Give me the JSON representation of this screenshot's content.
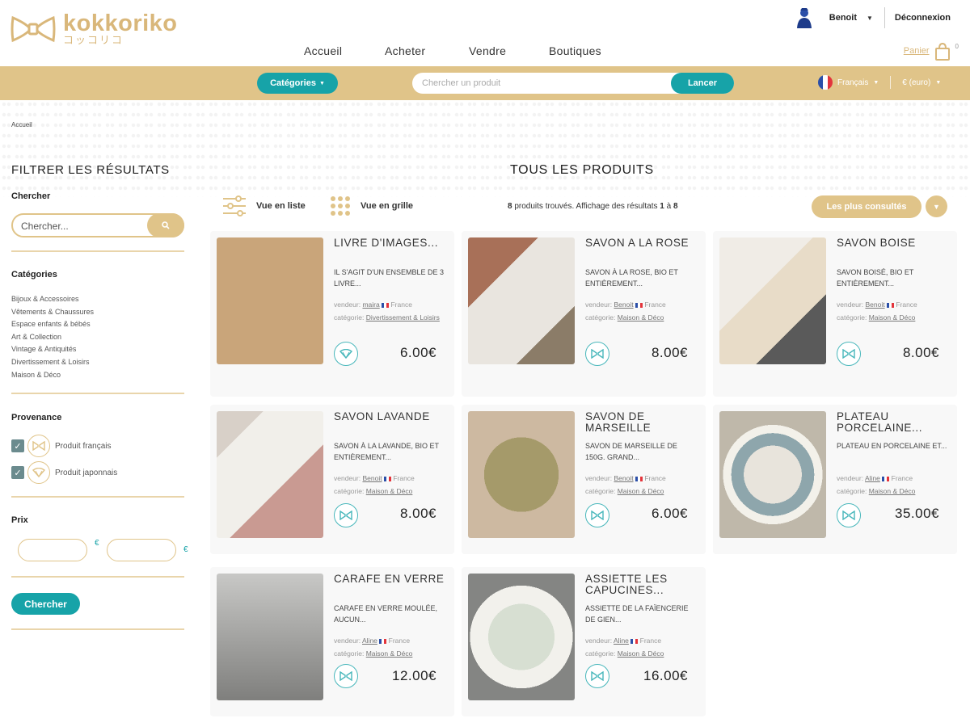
{
  "header": {
    "logo_name": "kokkoriko",
    "logo_sub": "コッコリコ",
    "user_name": "Benoit",
    "logout": "Déconnexion",
    "nav": [
      "Accueil",
      "Acheter",
      "Vendre",
      "Boutiques"
    ],
    "cart_label": "Panier",
    "cart_count": "0"
  },
  "strip": {
    "categories_label": "Catégories",
    "search_placeholder": "Chercher un produit",
    "launch_label": "Lancer",
    "language": "Français",
    "currency": "€ (euro)"
  },
  "breadcrumb": "Accueil",
  "sidebar": {
    "title": "FILTRER LES RÉSULTATS",
    "search_heading": "Chercher",
    "search_placeholder": "Chercher...",
    "categories_heading": "Catégories",
    "categories": [
      "Bijoux & Accessoires",
      "Vêtements & Chaussures",
      "Espace enfants & bébés",
      "Art & Collection",
      "Vintage & Antiquités",
      "Divertissement & Loisirs",
      "Maison & Déco"
    ],
    "provenance_heading": "Provenance",
    "provenance": [
      "Produit français",
      "Produit japonnais"
    ],
    "price_heading": "Prix",
    "currency_symbol": "€",
    "search_button": "Chercher"
  },
  "main": {
    "title": "TOUS LES PRODUITS",
    "list_view": "Vue en liste",
    "grid_view": "Vue en grille",
    "count_num": "8",
    "count_text": " produits trouvés. Affichage des résultats ",
    "range_start": "1",
    "range_sep": " à ",
    "range_end": "8",
    "sort_label": "Les plus consultés"
  },
  "products": [
    {
      "title": "LIVRE D'IMAGES...",
      "desc": "IL S'AGIT D'UN ENSEMBLE DE 3 LIVRE...",
      "seller_label": "vendeur:",
      "seller": "maira",
      "country": "France",
      "category_label": "catégorie:",
      "category": "Divertissement & Loisirs",
      "price": "6.00€",
      "badge": "japan"
    },
    {
      "title": "SAVON A LA ROSE",
      "desc": "SAVON À LA ROSE, BIO ET ENTIÈREMENT...",
      "seller_label": "vendeur:",
      "seller": "Benoit",
      "country": "France",
      "category_label": "catégorie:",
      "category": "Maison & Déco",
      "price": "8.00€",
      "badge": "france"
    },
    {
      "title": "SAVON BOISE",
      "desc": "SAVON BOISÉ, BIO ET ENTIÈREMENT...",
      "seller_label": "vendeur:",
      "seller": "Benoit",
      "country": "France",
      "category_label": "catégorie:",
      "category": "Maison & Déco",
      "price": "8.00€",
      "badge": "france"
    },
    {
      "title": "SAVON LAVANDE",
      "desc": "SAVON À LA LAVANDE, BIO ET ENTIÈREMENT...",
      "seller_label": "vendeur:",
      "seller": "Benoit",
      "country": "France",
      "category_label": "catégorie:",
      "category": "Maison & Déco",
      "price": "8.00€",
      "badge": "france"
    },
    {
      "title": "SAVON DE MARSEILLE",
      "desc": "SAVON DE MARSEILLE DE 150G. GRAND...",
      "seller_label": "vendeur:",
      "seller": "Benoit",
      "country": "France",
      "category_label": "catégorie:",
      "category": "Maison & Déco",
      "price": "6.00€",
      "badge": "france"
    },
    {
      "title": "PLATEAU PORCELAINE...",
      "desc": "PLATEAU EN PORCELAINE ET...",
      "seller_label": "vendeur:",
      "seller": "Aline",
      "country": "France",
      "category_label": "catégorie:",
      "category": "Maison & Déco",
      "price": "35.00€",
      "badge": "france"
    },
    {
      "title": "CARAFE EN VERRE",
      "desc": "CARAFE EN VERRE MOULÉE, AUCUN...",
      "seller_label": "vendeur:",
      "seller": "Aline",
      "country": "France",
      "category_label": "catégorie:",
      "category": "Maison & Déco",
      "price": "12.00€",
      "badge": "france"
    },
    {
      "title": "ASSIETTE LES CAPUCINES...",
      "desc": "ASSIETTE DE LA FAÏENCERIE DE GIEN...",
      "seller_label": "vendeur:",
      "seller": "Aline",
      "country": "France",
      "category_label": "catégorie:",
      "category": "Maison & Déco",
      "price": "16.00€",
      "badge": "france"
    }
  ],
  "colors": {
    "gold": "#e0c489",
    "teal": "#17a3a8",
    "logo": "#d9b77a"
  }
}
